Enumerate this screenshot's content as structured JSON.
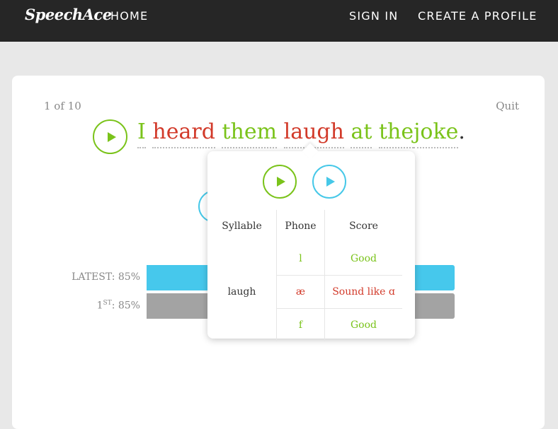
{
  "nav": {
    "logo": "SpeechAce",
    "home": "HOME",
    "sign_in": "SIGN IN",
    "create_profile": "CREATE A PROFILE"
  },
  "quiz": {
    "progress": "1 of 10",
    "quit": "Quit"
  },
  "sentence": {
    "words": [
      {
        "text": "I",
        "quality": "good"
      },
      {
        "text": "heard",
        "quality": "bad"
      },
      {
        "text": "them",
        "quality": "good"
      },
      {
        "text": "laugh",
        "quality": "bad"
      },
      {
        "text": "at",
        "quality": "good"
      },
      {
        "text": "the",
        "quality": "good"
      },
      {
        "text": "joke",
        "quality": "good"
      }
    ],
    "punctuation": "."
  },
  "scores": {
    "latest_label": "LATEST: 85%",
    "first_prefix": "1",
    "first_sup": "ST",
    "first_suffix": ": 85%",
    "latest_value": 85,
    "first_value": 85
  },
  "popover": {
    "headers": {
      "syllable": "Syllable",
      "phone": "Phone",
      "score": "Score"
    },
    "syllable": "laugh",
    "rows": [
      {
        "phone": "l",
        "score": "Good",
        "quality": "good"
      },
      {
        "phone": "æ",
        "score": "Sound like ɑ",
        "quality": "bad"
      },
      {
        "phone": "f",
        "score": "Good",
        "quality": "good"
      }
    ]
  },
  "colors": {
    "good": "#7ac31a",
    "bad": "#d23a2a",
    "accent_blue": "#46c8ec",
    "first_bar": "#a3a3a3",
    "topbar": "#262626"
  }
}
